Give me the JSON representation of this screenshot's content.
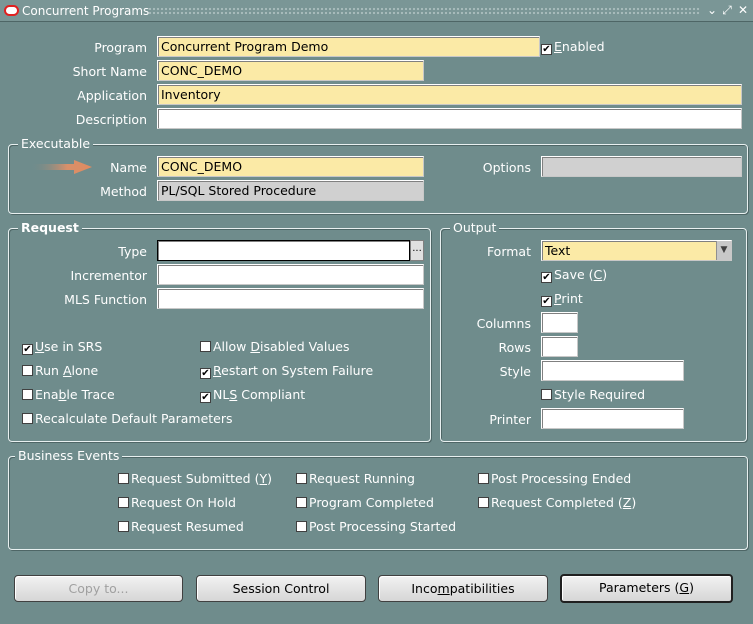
{
  "window": {
    "title": "Concurrent Programs",
    "controls": {
      "minimize": "⌄",
      "maximize": "⤢",
      "close": "✕"
    }
  },
  "header": {
    "program_label": "Program",
    "program_value": "Concurrent Program Demo",
    "enabled_label_pre": "",
    "enabled_mnemonic": "E",
    "enabled_label_post": "nabled",
    "enabled_checked": "✔",
    "short_name_label": "Short Name",
    "short_name_value": "CONC_DEMO",
    "application_label": "Application",
    "application_value": "Inventory",
    "description_label": "Description",
    "description_value": ""
  },
  "executable": {
    "title": "Executable",
    "name_label": "Name",
    "name_value": "CONC_DEMO",
    "method_label": "Method",
    "method_value": "PL/SQL Stored Procedure",
    "options_label": "Options",
    "options_value": ""
  },
  "request": {
    "title": "Request",
    "type_label": "Type",
    "type_value": "",
    "lov_glyph": "...",
    "incrementor_label": "Incrementor",
    "mls_label": "MLS Function",
    "checkboxes": {
      "use_in_srs": {
        "pre": "",
        "mn": "U",
        "post": "se in SRS",
        "mark": "✔"
      },
      "allow_disabled": {
        "pre": "Allow ",
        "mn": "D",
        "post": "isabled Values",
        "mark": ""
      },
      "run_alone": {
        "pre": "Run ",
        "mn": "A",
        "post": "lone",
        "mark": ""
      },
      "restart": {
        "pre": "",
        "mn": "R",
        "post": "estart on System Failure",
        "mark": "✔"
      },
      "enable_trace": {
        "pre": "Ena",
        "mn": "b",
        "post": "le Trace",
        "mark": ""
      },
      "nls": {
        "pre": "NL",
        "mn": "S",
        "post": " Compliant",
        "mark": "✔"
      },
      "recalc": {
        "pre": "Recalculate Default Parameters",
        "mn": "",
        "post": "",
        "mark": ""
      }
    }
  },
  "output": {
    "title": "Output",
    "format_label": "Format",
    "format_value": "Text",
    "dropdown_glyph": "▼",
    "save": {
      "pre": "Save (",
      "mn": "C",
      "post": ")",
      "mark": "✔"
    },
    "print": {
      "pre": "",
      "mn": "P",
      "post": "rint",
      "mark": "✔"
    },
    "columns_label": "Columns",
    "rows_label": "Rows",
    "style_label": "Style",
    "style_required": {
      "pre": "Style Required",
      "mn": "",
      "post": "",
      "mark": ""
    },
    "printer_label": "Printer"
  },
  "business_events": {
    "title": "Business Events",
    "items": {
      "req_submitted": {
        "pre": "Request Submitted (",
        "mn": "Y",
        "post": ")",
        "mark": ""
      },
      "req_running": {
        "pre": "Request Running",
        "mn": "",
        "post": "",
        "mark": ""
      },
      "post_ended": {
        "pre": "Post Processing Ended",
        "mn": "",
        "post": "",
        "mark": ""
      },
      "req_on_hold": {
        "pre": "Request On Hold",
        "mn": "",
        "post": "",
        "mark": ""
      },
      "prog_completed": {
        "pre": "Program Completed",
        "mn": "",
        "post": "",
        "mark": ""
      },
      "req_completed": {
        "pre": "Request Completed (",
        "mn": "Z",
        "post": ")",
        "mark": ""
      },
      "req_resumed": {
        "pre": "Request Resumed",
        "mn": "",
        "post": "",
        "mark": ""
      },
      "post_started": {
        "pre": "Post Processing Started",
        "mn": "",
        "post": "",
        "mark": ""
      }
    }
  },
  "buttons": {
    "copy_to": "Copy to...",
    "session_control": "Session Control",
    "incompat_pre": "Inco",
    "incompat_mn": "m",
    "incompat_post": "patibilities",
    "params_pre": "Parameters (",
    "params_mn": "G",
    "params_post": ")"
  },
  "colors": {
    "background": "#6f8c8c",
    "required_field": "#fbeaa6",
    "arrow": "#d9906a"
  },
  "icons": {
    "logo": "oracle-logo-icon",
    "arrow": "pointer-arrow-icon"
  }
}
